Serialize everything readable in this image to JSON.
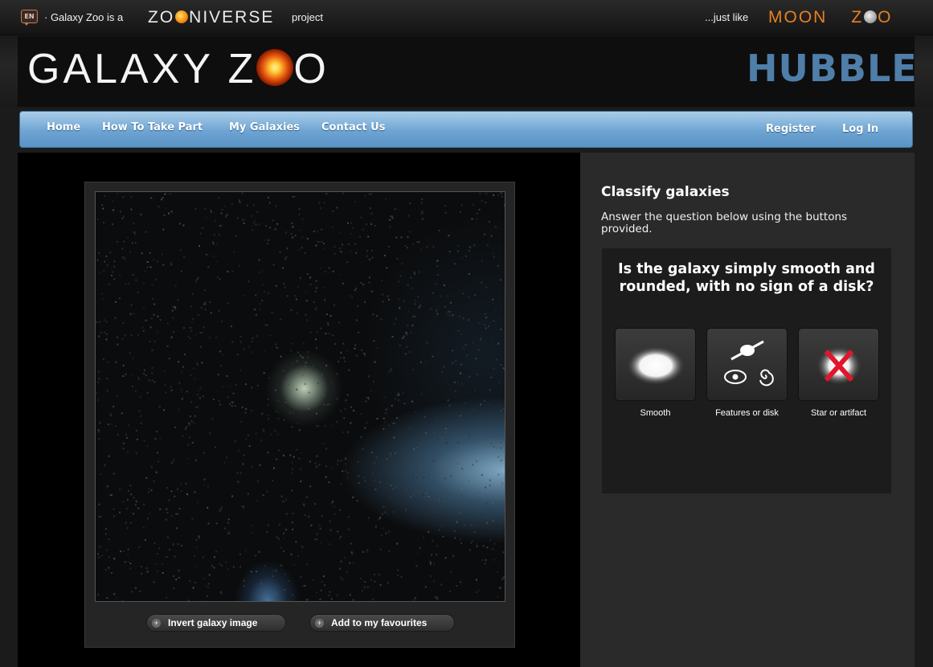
{
  "topbar": {
    "lang": "EN",
    "tagline": "· Galaxy Zoo is a",
    "zooniverse_a": "ZO",
    "zooniverse_b": "NIVERSE",
    "project_word": "project",
    "just_like": "...just like",
    "moon_a": "MOON",
    "moon_b": "Z",
    "moon_c": "O"
  },
  "header": {
    "logo_a": "GALAXY Z",
    "logo_b": "O",
    "edition": "HUBBLE"
  },
  "nav": {
    "items": [
      "Home",
      "How To Take Part",
      "My Galaxies",
      "Contact Us"
    ],
    "register": "Register",
    "login": "Log In"
  },
  "image_actions": {
    "invert": "Invert galaxy image",
    "favourite": "Add to my favourites"
  },
  "classify": {
    "title": "Classify galaxies",
    "description": "Answer the question below using the buttons provided.",
    "question": "Is the galaxy simply smooth and rounded, with no sign of a disk?",
    "answers": [
      "Smooth",
      "Features or disk",
      "Star or artifact"
    ]
  },
  "colors": {
    "nav_blue": "#6ea4d2",
    "hubble_blue": "#4f7ea8",
    "artifact_red": "#e0162b"
  },
  "icons": [
    "speech-bubble-icon",
    "smooth-galaxy-icon",
    "features-disk-icon",
    "star-artifact-icon",
    "plus-icon"
  ]
}
